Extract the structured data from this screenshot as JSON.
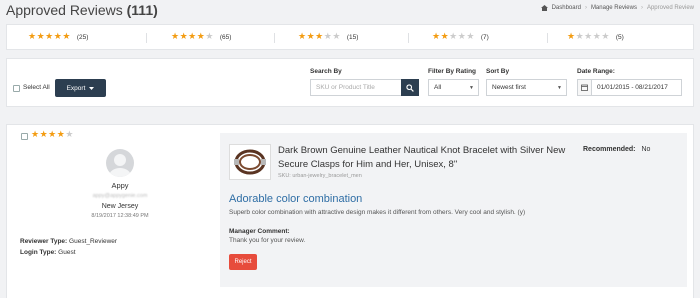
{
  "header": {
    "title": "Approved Reviews",
    "count": "(111)",
    "breadcrumb": {
      "dashboard": "Dashboard",
      "manage": "Manage Reviews",
      "current": "Approved Review"
    }
  },
  "summary": [
    {
      "stars": 5,
      "count": "(25)"
    },
    {
      "stars": 4,
      "count": "(65)"
    },
    {
      "stars": 3,
      "count": "(15)"
    },
    {
      "stars": 2,
      "count": "(7)"
    },
    {
      "stars": 1,
      "count": "(5)"
    }
  ],
  "filters": {
    "select_all": "Select All",
    "export": "Export",
    "search_label": "Search By",
    "search_placeholder": "SKU or Product Title",
    "rating_label": "Filter By Rating",
    "rating_value": "All",
    "sort_label": "Sort By",
    "sort_value": "Newest first",
    "date_label": "Date Range:",
    "date_value": "01/01/2015 - 08/21/2017"
  },
  "review": {
    "rating": 4,
    "user_name": "Appy",
    "user_email": "appy@appygenie.com",
    "location": "New Jersey",
    "date": "8/19/2017 12:38:49 PM",
    "reviewer_type_label": "Reviewer Type:",
    "reviewer_type": "Guest_Reviewer",
    "login_type_label": "Login Type:",
    "login_type": "Guest",
    "product_title": "Dark Brown Genuine Leather Nautical Knot Bracelet with Silver New Secure Clasps for Him and Her, Unisex, 8\"",
    "sku": "SKU: urban-jewelry_bracelet_men",
    "recommended_label": "Recommended:",
    "recommended_value": "No",
    "review_title": "Adorable color combination",
    "review_text": "Superb color combination with attractive design makes it different from others. Very cool and stylish. (y)",
    "manager_comment_label": "Manager Comment:",
    "manager_comment": "Thank you for your review.",
    "reject_label": "Reject"
  },
  "colors": {
    "star": "#f39c12",
    "primary": "#2c3e50",
    "link": "#2f6ea5",
    "danger": "#e74c3c"
  }
}
